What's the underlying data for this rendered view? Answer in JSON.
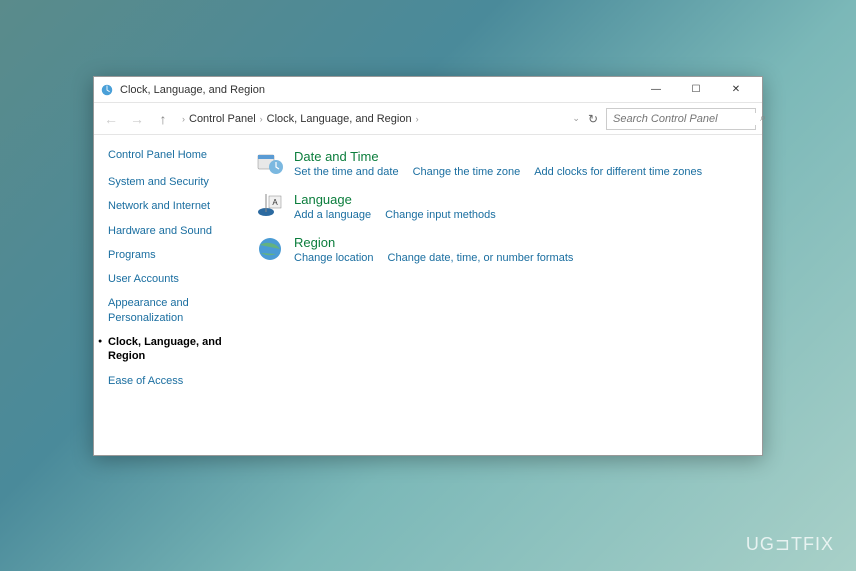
{
  "window": {
    "title": "Clock, Language, and Region"
  },
  "breadcrumb": {
    "items": [
      "Control Panel",
      "Clock, Language, and Region"
    ]
  },
  "search": {
    "placeholder": "Search Control Panel"
  },
  "sidebar": {
    "home_label": "Control Panel Home",
    "items": [
      {
        "label": "System and Security",
        "active": false
      },
      {
        "label": "Network and Internet",
        "active": false
      },
      {
        "label": "Hardware and Sound",
        "active": false
      },
      {
        "label": "Programs",
        "active": false
      },
      {
        "label": "User Accounts",
        "active": false
      },
      {
        "label": "Appearance and Personalization",
        "active": false
      },
      {
        "label": "Clock, Language, and Region",
        "active": true
      },
      {
        "label": "Ease of Access",
        "active": false
      }
    ]
  },
  "categories": [
    {
      "title": "Date and Time",
      "icon": "clock-icon",
      "links": [
        "Set the time and date",
        "Change the time zone",
        "Add clocks for different time zones"
      ]
    },
    {
      "title": "Language",
      "icon": "language-icon",
      "links": [
        "Add a language",
        "Change input methods"
      ]
    },
    {
      "title": "Region",
      "icon": "region-icon",
      "links": [
        "Change location",
        "Change date, time, or number formats"
      ]
    }
  ],
  "watermark": "UG⊐TFIX"
}
